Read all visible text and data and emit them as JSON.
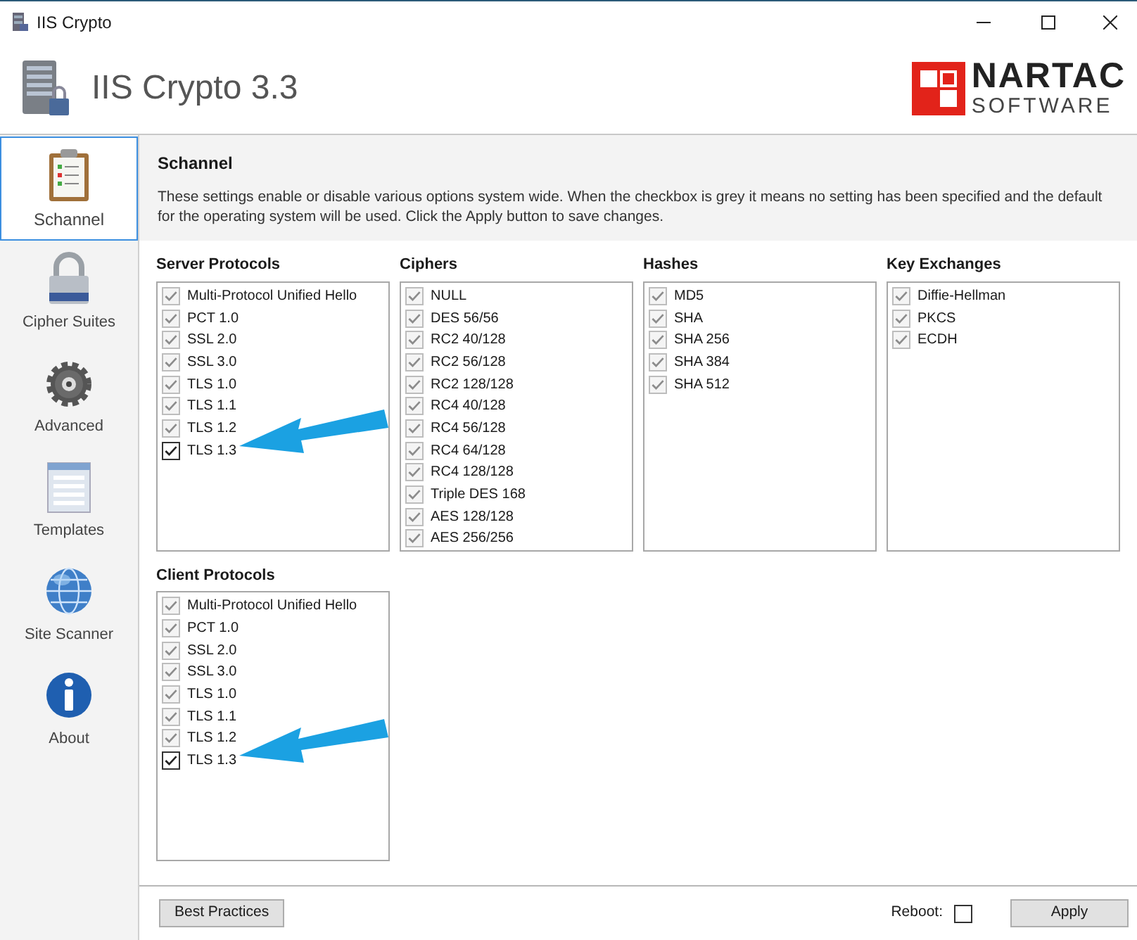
{
  "window": {
    "title": "IIS Crypto"
  },
  "header": {
    "title": "IIS Crypto 3.3",
    "logo_line_1": "NARTAC",
    "logo_line_2": "SOFTWARE"
  },
  "sidebar": {
    "items": [
      {
        "label": "Schannel",
        "selected": true
      },
      {
        "label": "Cipher Suites",
        "selected": false
      },
      {
        "label": "Advanced",
        "selected": false
      },
      {
        "label": "Templates",
        "selected": false
      },
      {
        "label": "Site Scanner",
        "selected": false
      },
      {
        "label": "About",
        "selected": false
      }
    ]
  },
  "section": {
    "title": "Schannel",
    "description": "These settings enable or disable various options system wide. When the checkbox is grey it means no setting has been specified and the default for the operating system will be used. Click the Apply button to save changes."
  },
  "groups": [
    {
      "title": "Server Protocols",
      "items": [
        {
          "label": "Multi-Protocol Unified Hello",
          "checked": true,
          "disabled": true
        },
        {
          "label": "PCT 1.0",
          "checked": true,
          "disabled": true
        },
        {
          "label": "SSL 2.0",
          "checked": true,
          "disabled": true
        },
        {
          "label": "SSL 3.0",
          "checked": true,
          "disabled": true
        },
        {
          "label": "TLS 1.0",
          "checked": true,
          "disabled": true
        },
        {
          "label": "TLS 1.1",
          "checked": true,
          "disabled": true
        },
        {
          "label": "TLS 1.2",
          "checked": true,
          "disabled": true
        },
        {
          "label": "TLS 1.3",
          "checked": true,
          "disabled": false
        }
      ]
    },
    {
      "title": "Ciphers",
      "items": [
        {
          "label": "NULL",
          "checked": true,
          "disabled": true
        },
        {
          "label": "DES 56/56",
          "checked": true,
          "disabled": true
        },
        {
          "label": "RC2 40/128",
          "checked": true,
          "disabled": true
        },
        {
          "label": "RC2 56/128",
          "checked": true,
          "disabled": true
        },
        {
          "label": "RC2 128/128",
          "checked": true,
          "disabled": true
        },
        {
          "label": "RC4 40/128",
          "checked": true,
          "disabled": true
        },
        {
          "label": "RC4 56/128",
          "checked": true,
          "disabled": true
        },
        {
          "label": "RC4 64/128",
          "checked": true,
          "disabled": true
        },
        {
          "label": "RC4 128/128",
          "checked": true,
          "disabled": true
        },
        {
          "label": "Triple DES 168",
          "checked": true,
          "disabled": true
        },
        {
          "label": "AES 128/128",
          "checked": true,
          "disabled": true
        },
        {
          "label": "AES 256/256",
          "checked": true,
          "disabled": true
        }
      ]
    },
    {
      "title": "Hashes",
      "items": [
        {
          "label": "MD5",
          "checked": true,
          "disabled": true
        },
        {
          "label": "SHA",
          "checked": true,
          "disabled": true
        },
        {
          "label": "SHA 256",
          "checked": true,
          "disabled": true
        },
        {
          "label": "SHA 384",
          "checked": true,
          "disabled": true
        },
        {
          "label": "SHA 512",
          "checked": true,
          "disabled": true
        }
      ]
    },
    {
      "title": "Key Exchanges",
      "items": [
        {
          "label": "Diffie-Hellman",
          "checked": true,
          "disabled": true
        },
        {
          "label": "PKCS",
          "checked": true,
          "disabled": true
        },
        {
          "label": "ECDH",
          "checked": true,
          "disabled": true
        }
      ]
    },
    {
      "title": "Client Protocols",
      "items": [
        {
          "label": "Multi-Protocol Unified Hello",
          "checked": true,
          "disabled": true
        },
        {
          "label": "PCT 1.0",
          "checked": true,
          "disabled": true
        },
        {
          "label": "SSL 2.0",
          "checked": true,
          "disabled": true
        },
        {
          "label": "SSL 3.0",
          "checked": true,
          "disabled": true
        },
        {
          "label": "TLS 1.0",
          "checked": true,
          "disabled": true
        },
        {
          "label": "TLS 1.1",
          "checked": true,
          "disabled": true
        },
        {
          "label": "TLS 1.2",
          "checked": true,
          "disabled": true
        },
        {
          "label": "TLS 1.3",
          "checked": true,
          "disabled": false
        }
      ]
    }
  ],
  "footer": {
    "best_practices": "Best Practices",
    "reboot_label": "Reboot:",
    "reboot_checked": false,
    "apply": "Apply"
  }
}
